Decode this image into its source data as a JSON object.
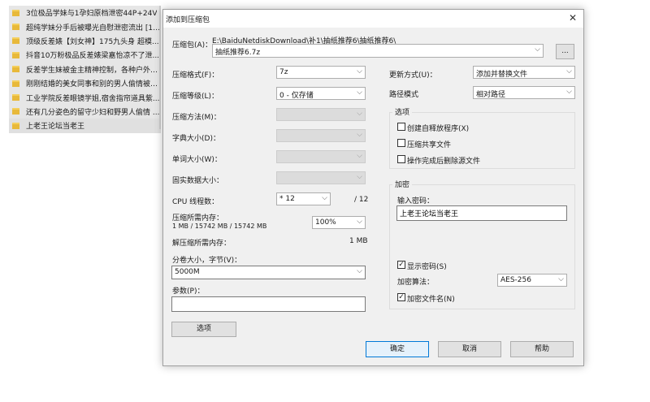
{
  "file_list": {
    "items": [
      "3位极品学妹与1孕妇原档泄密44P+24V",
      "超纯学妹分手后被曝光自慰泄密流出 [1V...",
      "顶级反差婊【刘女神】175九头身 超模...",
      "抖音10万粉极品反差婊梁嘉怡凉不了泄...",
      "反差学生妹被金主精神控制，各种户外露...",
      "刚刚结婚的美女同事和别的男人偷情被老...",
      "工业学院反差眼镜学姐,宿舍指帘道具紫...",
      "还有几分姿色的留守少妇和野男人偷情 ...",
      "上老王论坛当老王"
    ]
  },
  "dialog": {
    "title": "添加到压缩包",
    "close_glyph": "✕",
    "archive_label": "压缩包(A)：",
    "archive_path": "E:\\BaiduNetdiskDownload\\补1\\抽纸推荐6\\抽纸推荐6\\",
    "archive_name": "抽纸推荐6.7z",
    "browse_label": "...",
    "format_label": "压缩格式(F)：",
    "format_value": "7z",
    "level_label": "压缩等级(L)：",
    "level_value": "0 - 仅存储",
    "method_label": "压缩方法(M)：",
    "dict_label": "字典大小(D)：",
    "word_label": "单词大小(W)：",
    "solid_label": "固实数据大小：",
    "cpu_label": "CPU 线程数：",
    "cpu_value": "* 12",
    "cpu_max": "/ 12",
    "mem_comp_label": "压缩所需内存：",
    "mem_comp_value": "1 MB / 15742 MB / 15742 MB",
    "mem_percent": "100%",
    "mem_decomp_label": "解压缩所需内存：",
    "mem_decomp_value": "1 MB",
    "split_label": "分卷大小，字节(V)：",
    "split_value": "5000M",
    "params_label": "参数(P)：",
    "params_value": "",
    "options_button": "选项",
    "update_label": "更新方式(U)：",
    "update_value": "添加并替换文件",
    "path_label": "路径模式",
    "path_value": "相对路径",
    "options_group": "选项",
    "opt_sfx": "创建自释放程序(X)",
    "opt_shared": "压缩共享文件",
    "opt_delete": "操作完成后删除源文件",
    "encrypt_group": "加密",
    "pw_label": "输入密码：",
    "pw_value": "上老王论坛当老王",
    "show_pw": "显示密码(S)",
    "enc_method_label": "加密算法：",
    "enc_method_value": "AES-256",
    "enc_names": "加密文件名(N)",
    "check_glyph": "✓",
    "arrow_glyph": "⌵",
    "ok": "确定",
    "cancel": "取消",
    "help": "帮助"
  }
}
